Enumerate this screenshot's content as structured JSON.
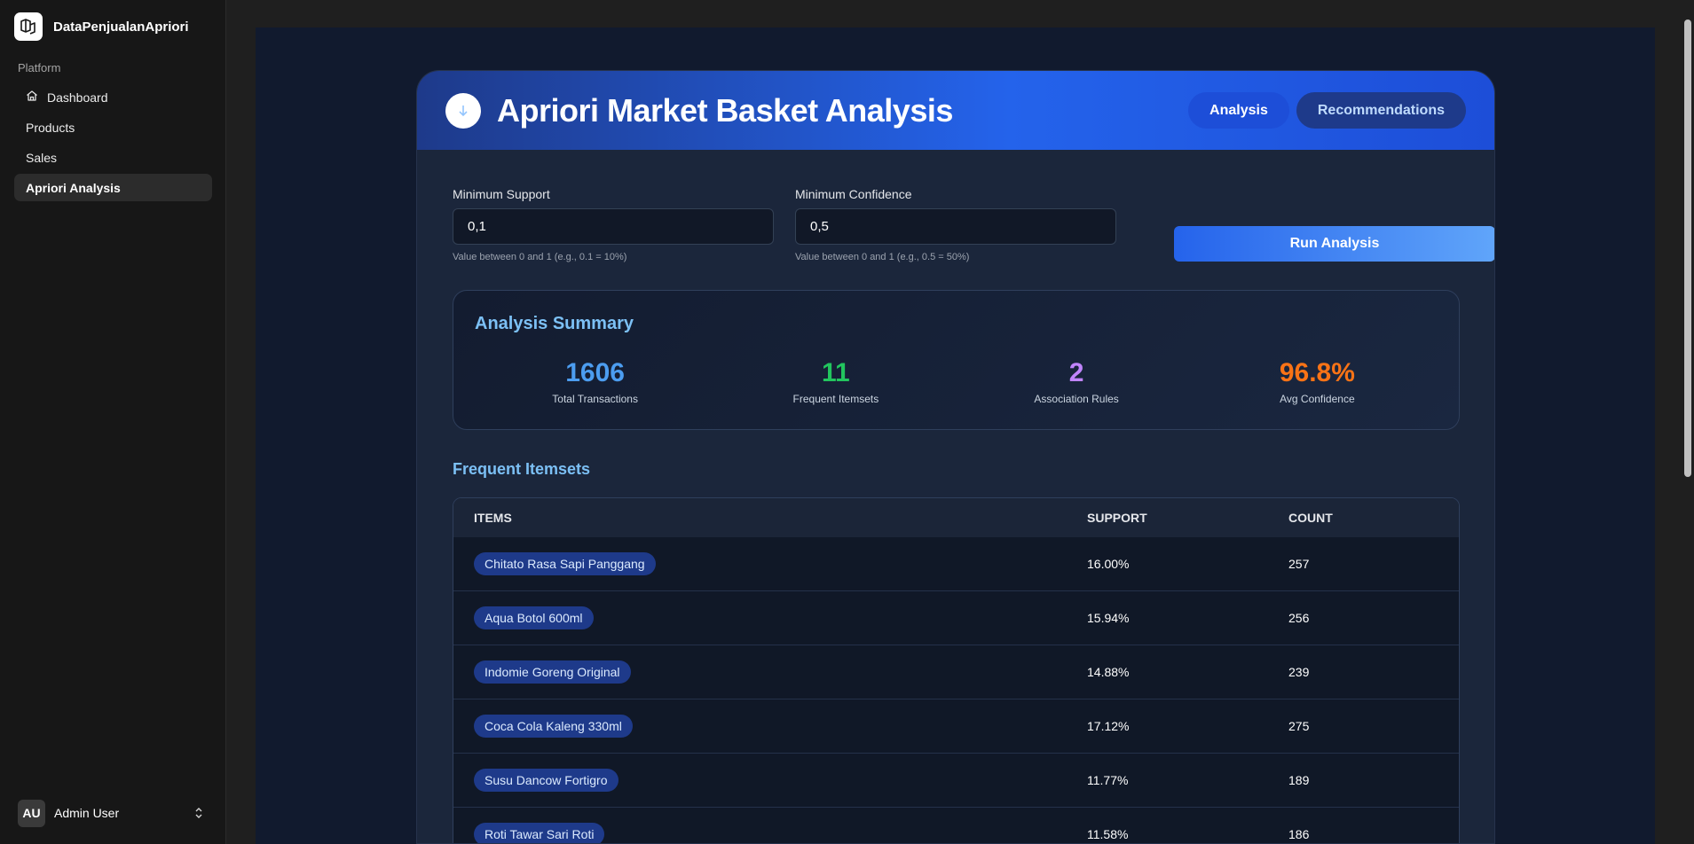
{
  "app": {
    "name": "DataPenjualanApriori"
  },
  "sidebar": {
    "group_label": "Platform",
    "items": [
      {
        "label": "Dashboard",
        "icon": "home-icon",
        "active": false
      },
      {
        "label": "Products",
        "active": false
      },
      {
        "label": "Sales",
        "active": false
      },
      {
        "label": "Apriori Analysis",
        "active": true
      }
    ]
  },
  "user": {
    "initials": "AU",
    "name": "Admin User"
  },
  "header": {
    "title": "Apriori Market Basket Analysis",
    "tabs": [
      {
        "label": "Analysis",
        "active": true
      },
      {
        "label": "Recommendations",
        "active": false
      }
    ]
  },
  "form": {
    "min_support": {
      "label": "Minimum Support",
      "value": "0,1",
      "hint": "Value between 0 and 1 (e.g., 0.1 = 10%)"
    },
    "min_confidence": {
      "label": "Minimum Confidence",
      "value": "0,5",
      "hint": "Value between 0 and 1 (e.g., 0.5 = 50%)"
    },
    "run_label": "Run Analysis"
  },
  "summary": {
    "title": "Analysis Summary",
    "stats": [
      {
        "value": "1606",
        "label": "Total Transactions",
        "color": "#4c9df0"
      },
      {
        "value": "11",
        "label": "Frequent Itemsets",
        "color": "#22c55e"
      },
      {
        "value": "2",
        "label": "Association Rules",
        "color": "#c084fc"
      },
      {
        "value": "96.8%",
        "label": "Avg Confidence",
        "color": "#f97316"
      }
    ]
  },
  "itemsets": {
    "title": "Frequent Itemsets",
    "columns": [
      "ITEMS",
      "SUPPORT",
      "COUNT"
    ],
    "rows": [
      {
        "item": "Chitato Rasa Sapi Panggang",
        "support": "16.00%",
        "count": "257"
      },
      {
        "item": "Aqua Botol 600ml",
        "support": "15.94%",
        "count": "256"
      },
      {
        "item": "Indomie Goreng Original",
        "support": "14.88%",
        "count": "239"
      },
      {
        "item": "Coca Cola Kaleng 330ml",
        "support": "17.12%",
        "count": "275"
      },
      {
        "item": "Susu Dancow Fortigro",
        "support": "11.77%",
        "count": "189"
      },
      {
        "item": "Roti Tawar Sari Roti",
        "support": "11.58%",
        "count": "186"
      }
    ]
  }
}
